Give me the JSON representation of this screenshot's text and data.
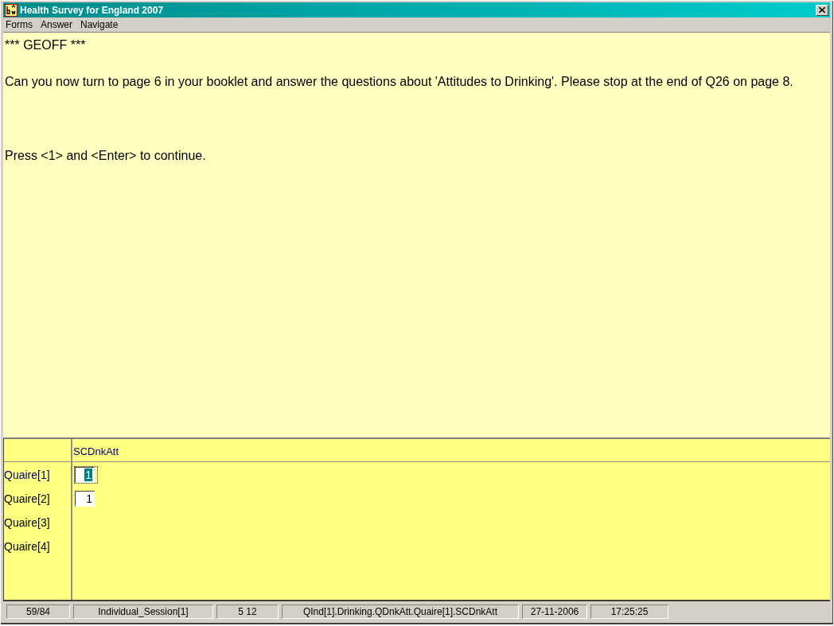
{
  "window": {
    "title": "Health Survey for England 2007"
  },
  "menu": [
    "Forms",
    "Answer",
    "Navigate"
  ],
  "question": {
    "paragraphs": [
      "*** GEOFF ***",
      "Can you now turn to page 6 in your booklet and answer the questions about 'Attitudes to Drinking'. Please stop at the end of Q26 on page 8.",
      "Press <1> and <Enter> to continue."
    ]
  },
  "grid": {
    "column": "SCDnkAtt",
    "rows": [
      {
        "label": "Quaire[1]",
        "answer": "1",
        "selected": true
      },
      {
        "label": "Quaire[2]",
        "answer": "1",
        "selected": false
      },
      {
        "label": "Quaire[3]",
        "selected": false
      },
      {
        "label": "Quaire[4]",
        "selected": false
      }
    ]
  },
  "status_bar": [
    "59/84",
    "Individual_Session[1]",
    "5 12",
    "QInd[1].Drinking.QDnkAtt.Quaire[1].SCDnkAtt",
    "27-11-2006",
    "17:25:25"
  ]
}
